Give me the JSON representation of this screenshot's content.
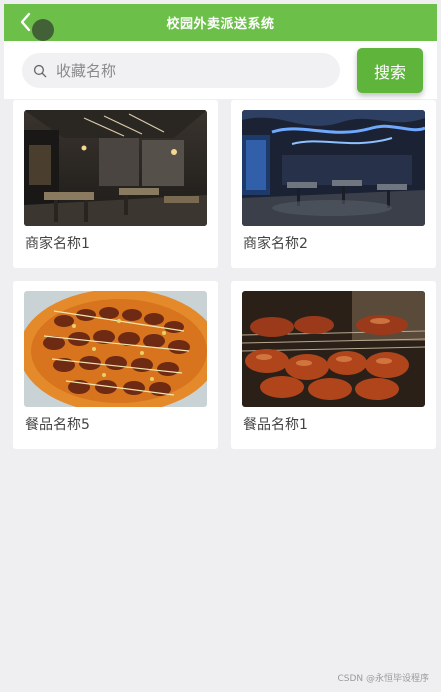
{
  "header": {
    "title": "校园外卖派送系统",
    "back_icon": "chevron-left-icon"
  },
  "search": {
    "placeholder": "收藏名称",
    "button_label": "搜索",
    "icon": "search-icon"
  },
  "favorites": [
    {
      "name": "商家名称1",
      "image": "restaurant-interior-dark"
    },
    {
      "name": "商家名称2",
      "image": "restaurant-interior-blue-lights"
    },
    {
      "name": "餐品名称5",
      "image": "food-skewers-plate"
    },
    {
      "name": "餐品名称1",
      "image": "food-grilled-meat"
    }
  ],
  "watermark": "CSDN @永恒毕设程序",
  "colors": {
    "header_bg": "#6cc04a",
    "search_button": "#5fb53c",
    "page_bg": "#efeff1"
  }
}
